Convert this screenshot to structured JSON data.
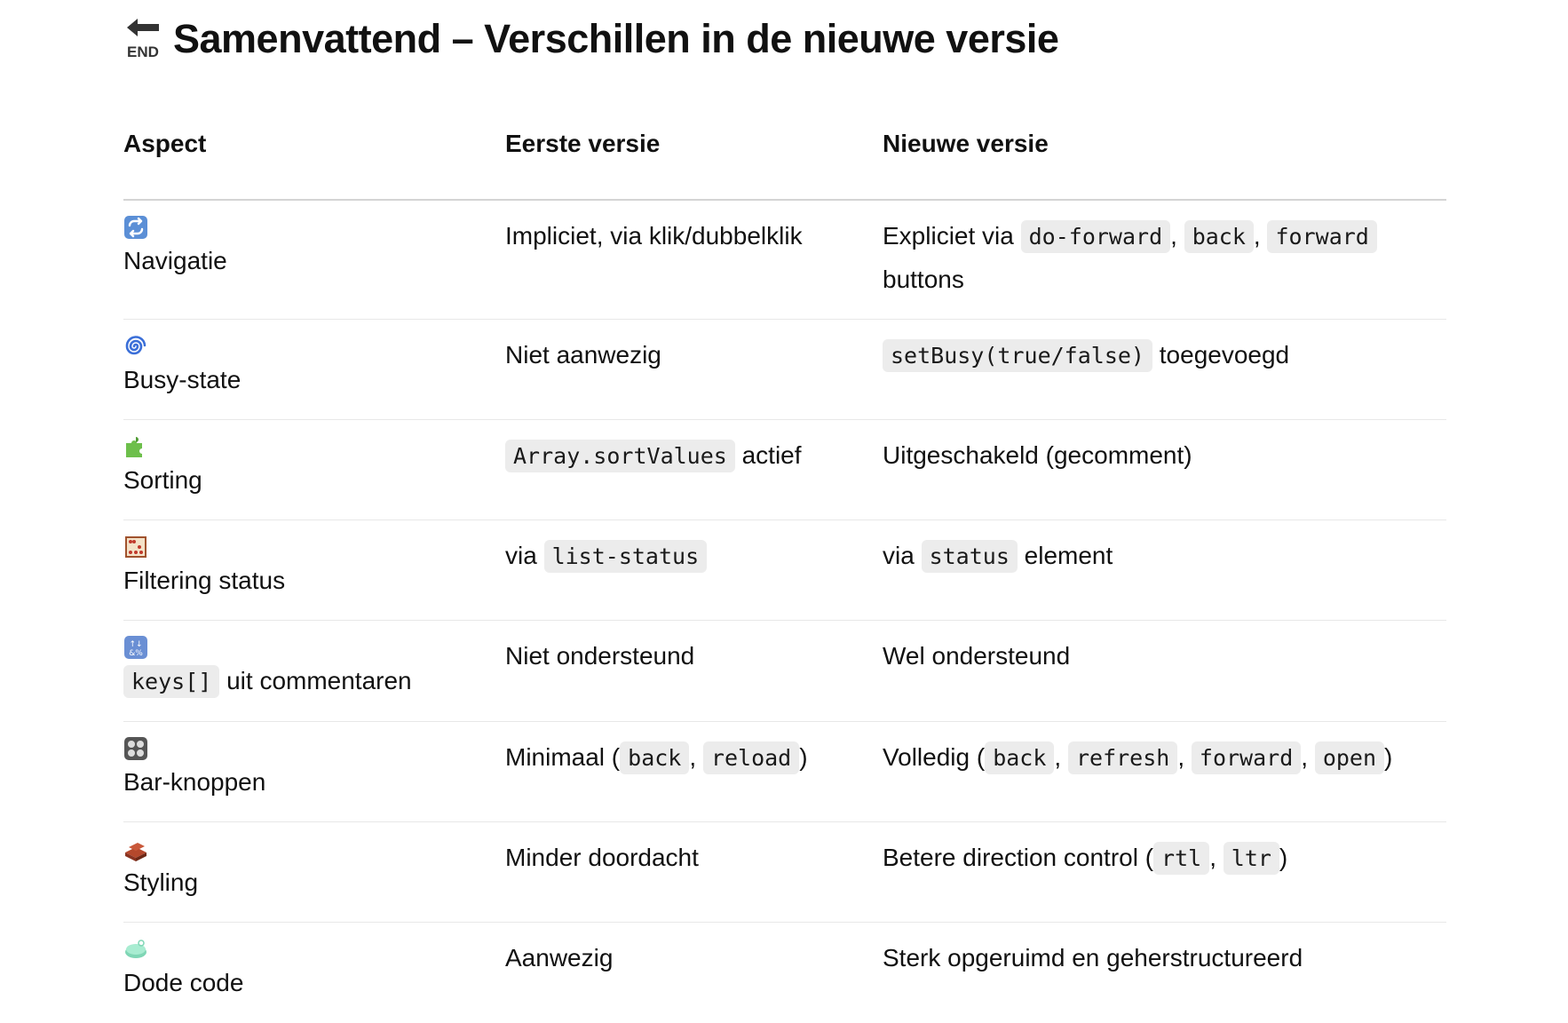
{
  "title": {
    "text": "Samenvattend – Verschillen in de nieuwe versie",
    "icon": "end-arrow-icon"
  },
  "table": {
    "headers": [
      "Aspect",
      "Eerste versie",
      "Nieuwe versie"
    ],
    "rows": [
      {
        "icon": "repeat-icon",
        "aspect": [
          {
            "t": "Navigatie"
          }
        ],
        "first": [
          {
            "t": "Impliciet, via klik/dubbelklik"
          }
        ],
        "new": [
          {
            "t": "Expliciet via "
          },
          {
            "c": "do-forward"
          },
          {
            "t": ", "
          },
          {
            "c": "back"
          },
          {
            "t": ", "
          },
          {
            "c": "forward"
          },
          {
            "t": " buttons"
          }
        ]
      },
      {
        "icon": "cyclone-icon",
        "aspect": [
          {
            "t": "Busy-state"
          }
        ],
        "first": [
          {
            "t": "Niet aanwezig"
          }
        ],
        "new": [
          {
            "c": "setBusy(true/false)"
          },
          {
            "t": " toegevoegd"
          }
        ]
      },
      {
        "icon": "puzzle-icon",
        "aspect": [
          {
            "t": "Sorting"
          }
        ],
        "first": [
          {
            "c": "Array.sortValues"
          },
          {
            "t": " actief"
          }
        ],
        "new": [
          {
            "t": "Uitgeschakeld (gecomment)"
          }
        ]
      },
      {
        "icon": "abacus-icon",
        "aspect": [
          {
            "t": "Filtering status"
          }
        ],
        "first": [
          {
            "t": "via "
          },
          {
            "c": "list-status"
          }
        ],
        "new": [
          {
            "t": "via "
          },
          {
            "c": "status"
          },
          {
            "t": " element"
          }
        ]
      },
      {
        "icon": "symbols-icon",
        "aspect": [
          {
            "c": "keys[]"
          },
          {
            "t": " uit commentaren"
          }
        ],
        "first": [
          {
            "t": "Niet ondersteund"
          }
        ],
        "new": [
          {
            "t": "Wel ondersteund"
          }
        ]
      },
      {
        "icon": "control-knobs-icon",
        "aspect": [
          {
            "t": "Bar-knoppen"
          }
        ],
        "first": [
          {
            "t": "Minimaal ("
          },
          {
            "c": "back"
          },
          {
            "t": ", "
          },
          {
            "c": "reload"
          },
          {
            "t": ")"
          }
        ],
        "new": [
          {
            "t": "Volledig ("
          },
          {
            "c": "back"
          },
          {
            "t": ", "
          },
          {
            "c": "refresh"
          },
          {
            "t": ", "
          },
          {
            "c": "forward"
          },
          {
            "t": ", "
          },
          {
            "c": "open"
          },
          {
            "t": ")"
          }
        ]
      },
      {
        "icon": "bricks-icon",
        "aspect": [
          {
            "t": "Styling"
          }
        ],
        "first": [
          {
            "t": "Minder doordacht"
          }
        ],
        "new": [
          {
            "t": "Betere direction control ("
          },
          {
            "c": "rtl"
          },
          {
            "t": ", "
          },
          {
            "c": "ltr"
          },
          {
            "t": ")"
          }
        ]
      },
      {
        "icon": "soap-icon",
        "aspect": [
          {
            "t": "Dode code"
          }
        ],
        "first": [
          {
            "t": "Aanwezig"
          }
        ],
        "new": [
          {
            "t": "Sterk opgeruimd en geherstructureerd"
          }
        ]
      }
    ]
  }
}
